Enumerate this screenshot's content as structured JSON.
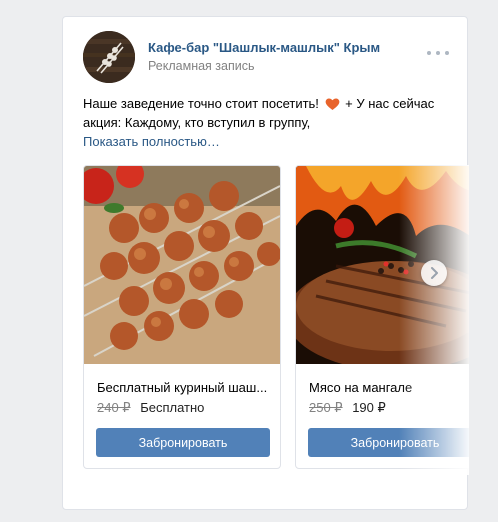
{
  "post": {
    "author": "Кафе-бар \"Шашлык-машлык\" Крым",
    "sublabel": "Рекламная запись",
    "text_line1_a": "Наше заведение точно стоит посетить!",
    "text_line1_b": "+ У нас сейчас",
    "text_line2": "акция: Каждому, кто вступил в группу,",
    "show_more": "Показать полностью…",
    "icons": {
      "avatar": "skewers-logo",
      "more": "more-dots-icon",
      "emoji": "heart-emoji",
      "next": "chevron-right-icon"
    },
    "colors": {
      "link": "#2a5885",
      "button": "#5181b8",
      "muted": "#828282"
    }
  },
  "cards": [
    {
      "title": "Бесплатный куриный шаш...",
      "old_price": "240 ₽",
      "new_price": "Бесплатно",
      "button": "Забронировать"
    },
    {
      "title": "Мясо на мангале",
      "old_price": "250 ₽",
      "new_price": "190 ₽",
      "button": "Забронировать"
    }
  ]
}
